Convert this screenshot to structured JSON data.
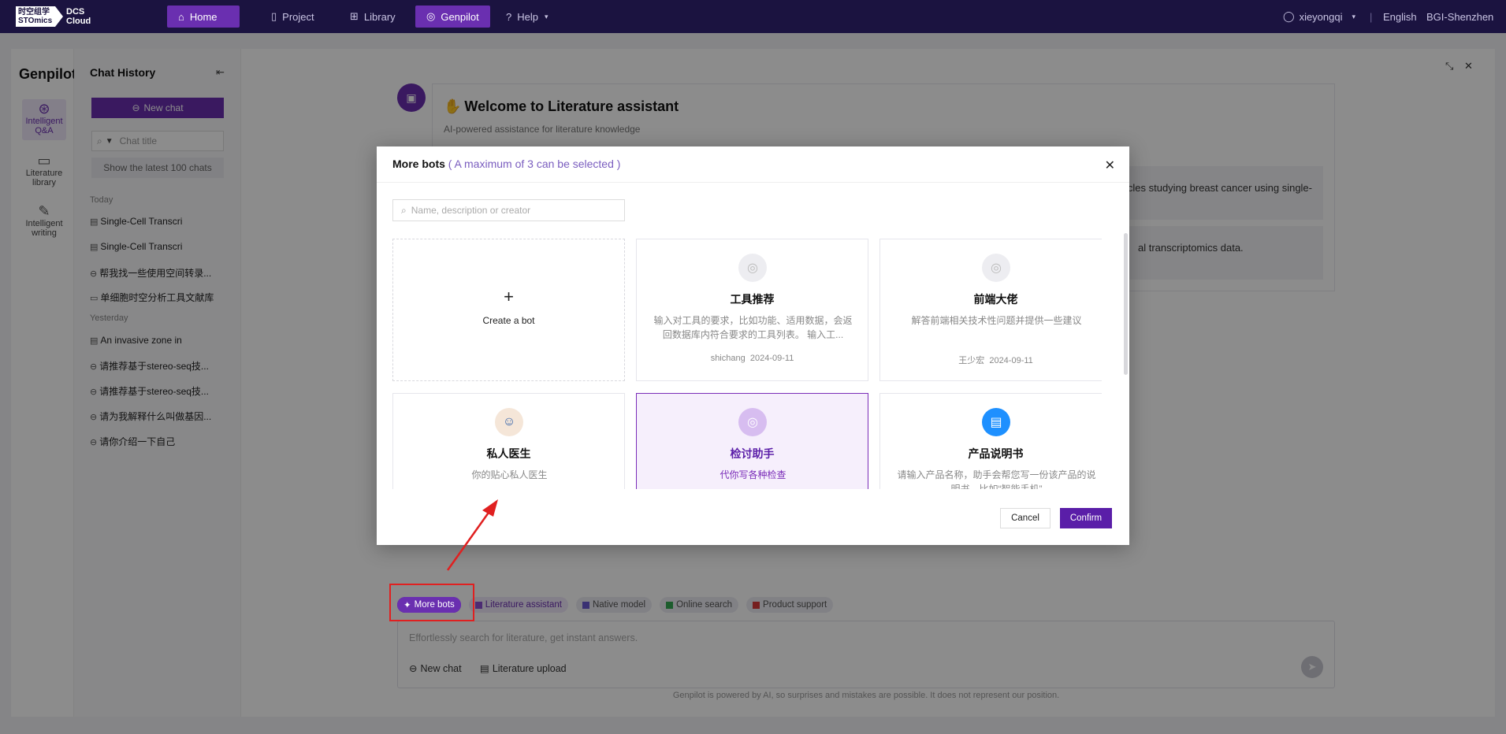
{
  "topbar": {
    "logo_line1": "时空组学",
    "logo_line2": "STOmics",
    "logo_product1": "DCS",
    "logo_product2": "Cloud",
    "nav": [
      {
        "label": "Home",
        "icon": "home-icon"
      },
      {
        "label": "Project",
        "icon": "file-icon"
      },
      {
        "label": "Library",
        "icon": "grid-icon"
      },
      {
        "label": "Genpilot",
        "icon": "genpilot-icon"
      },
      {
        "label": "Help",
        "icon": "help-icon"
      }
    ],
    "user": "xieyongqi",
    "language": "English",
    "region": "BGI-Shenzhen"
  },
  "rail": {
    "title": "Genpilot",
    "items": [
      {
        "label": "Intelligent Q&A"
      },
      {
        "label": "Literature library"
      },
      {
        "label": "Intelligent writing"
      }
    ]
  },
  "history": {
    "title": "Chat History",
    "new_chat": "New chat",
    "search_placeholder": "Chat title",
    "show_latest": "Show the latest 100 chats",
    "today_label": "Today",
    "yesterday_label": "Yesterday",
    "today_items": [
      "Single-Cell Transcri",
      "Single-Cell Transcri",
      "帮我找一些使用空间转录...",
      "单细胞时空分析工具文献库"
    ],
    "yesterday_items": [
      "An invasive zone in",
      "请推荐基于stereo-seq技...",
      "请推荐基于stereo-seq技...",
      "请为我解释什么叫做基因...",
      "请你介绍一下自己"
    ]
  },
  "welcome": {
    "title": "Welcome to Literature assistant",
    "subtitle": "AI-powered assistance for literature knowledge",
    "suggestion1": "cles studying breast cancer using single-",
    "suggestion2": "al transcriptomics data."
  },
  "chips": {
    "more_bots": "More bots",
    "literature_assistant": "Literature assistant",
    "native_model": "Native model",
    "online_search": "Online search",
    "product_support": "Product support"
  },
  "composer": {
    "placeholder": "Effortlessly search for literature, get instant answers.",
    "new_chat": "New chat",
    "upload": "Literature upload"
  },
  "footnote": "Genpilot is powered by AI, so surprises and mistakes are possible. It does not represent our position.",
  "modal": {
    "title": "More bots",
    "hint": "( A maximum of 3 can be selected )",
    "search_placeholder": "Name, description or creator",
    "create_label": "Create a bot",
    "bots": [
      {
        "name": "工具推荐",
        "desc": "输入对工具的要求，比如功能、适用数据，会返回数据库内符合要求的工具列表。 输入工...",
        "creator": "shichang",
        "date": "2024-09-11"
      },
      {
        "name": "前端大佬",
        "desc": "解答前端相关技术性问题并提供一些建议",
        "creator": "王少宏",
        "date": "2024-09-11"
      },
      {
        "name": "私人医生",
        "desc": "你的贴心私人医生",
        "creator": "",
        "date": ""
      },
      {
        "name": "检讨助手",
        "desc": "代你写各种检查",
        "creator": "",
        "date": ""
      },
      {
        "name": "产品说明书",
        "desc": "请输入产品名称，助手会帮您写一份该产品的说明书，比如“智能手机”",
        "creator": "",
        "date": ""
      }
    ],
    "cancel": "Cancel",
    "confirm": "Confirm"
  },
  "colors": {
    "brand": "#6a2fb0",
    "nav_bg": "#1b1340",
    "annotation": "#e02020"
  }
}
